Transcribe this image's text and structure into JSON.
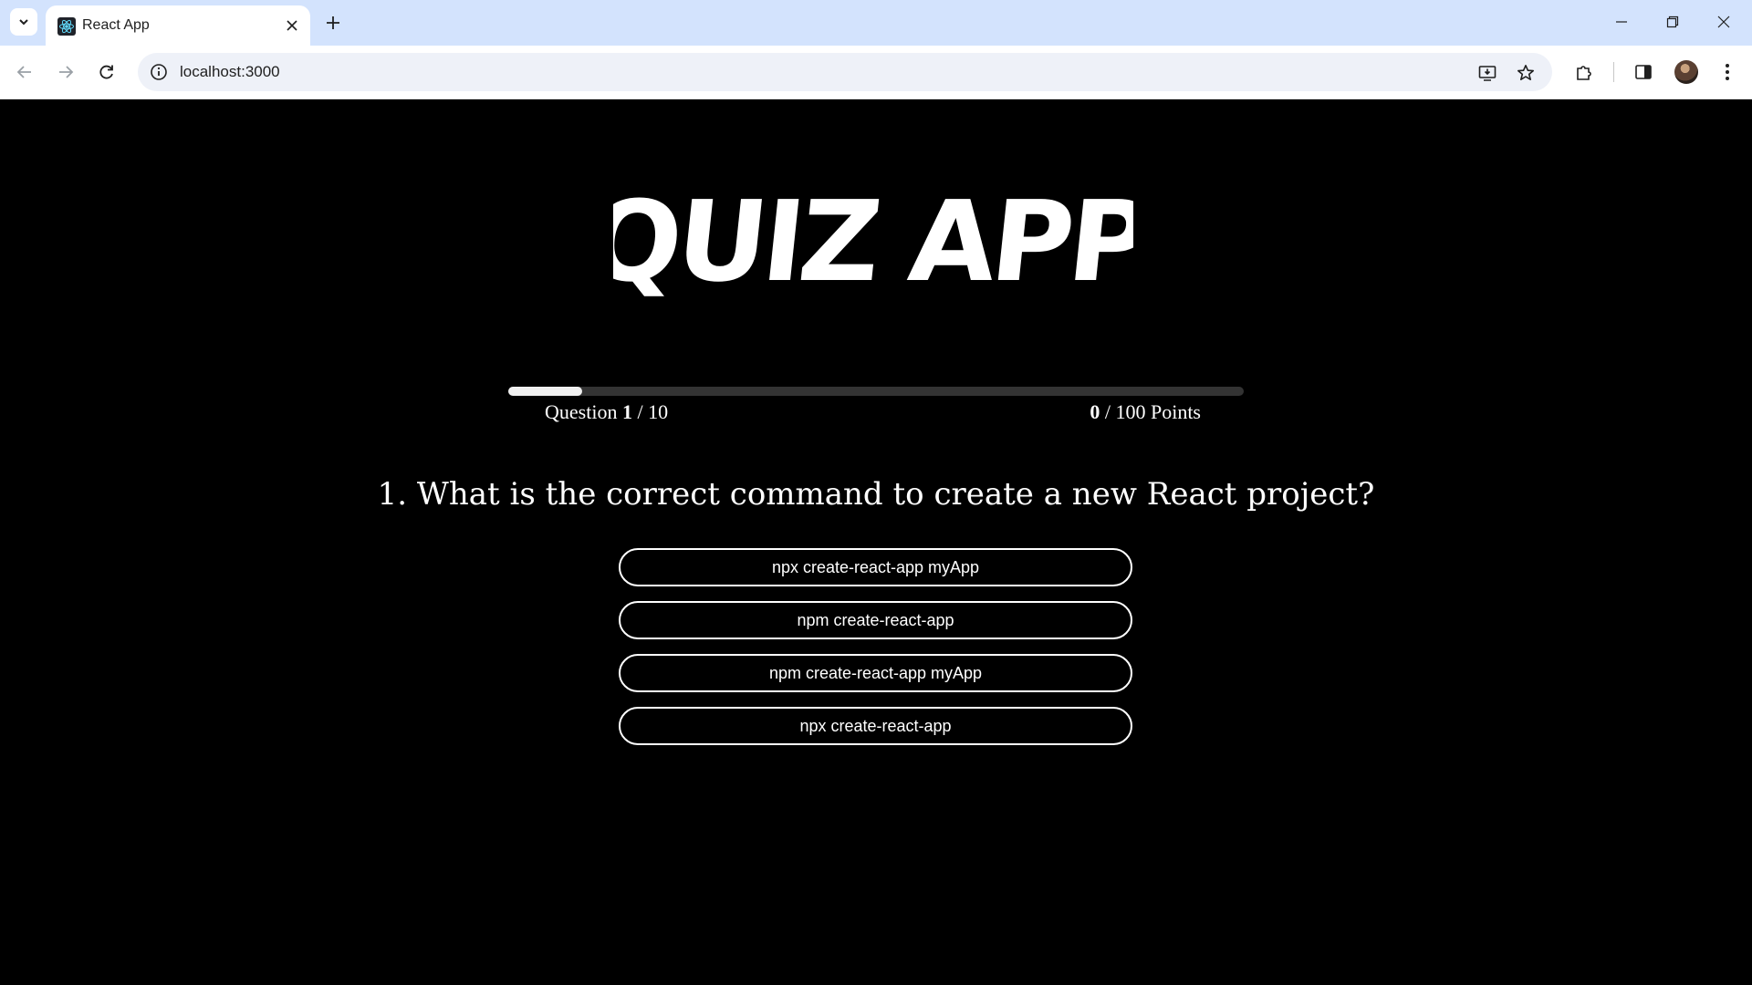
{
  "browser": {
    "tab_title": "React App",
    "url": "localhost:3000"
  },
  "quiz": {
    "logo_text": "QUIZ APP",
    "progress_fraction": 0.1,
    "question_label": "Question",
    "question_current": "1",
    "question_total_text": " / 10",
    "score_current": "0",
    "score_total_text": " / 100 Points",
    "question_text": "1. What is the correct command to create a new React project?",
    "answers": [
      "npx create-react-app myApp",
      "npm create-react-app",
      "npm create-react-app myApp",
      "npx create-react-app"
    ]
  },
  "colors": {
    "background": "#000000",
    "foreground": "#ffffff",
    "tabbar": "#d3e3fd"
  },
  "icons": {
    "tab_list": "chevron-down-icon",
    "favicon": "react-icon",
    "tab_close": "close-icon",
    "new_tab": "plus-icon",
    "minimize": "minimize-icon",
    "restore": "restore-icon",
    "close_window": "close-icon",
    "back": "back-arrow-icon",
    "forward": "forward-arrow-icon",
    "reload": "reload-icon",
    "site_info": "info-icon",
    "install": "install-app-icon",
    "bookmark": "star-icon",
    "extensions": "puzzle-icon",
    "side_panel": "side-panel-icon",
    "menu": "kebab-menu-icon"
  }
}
